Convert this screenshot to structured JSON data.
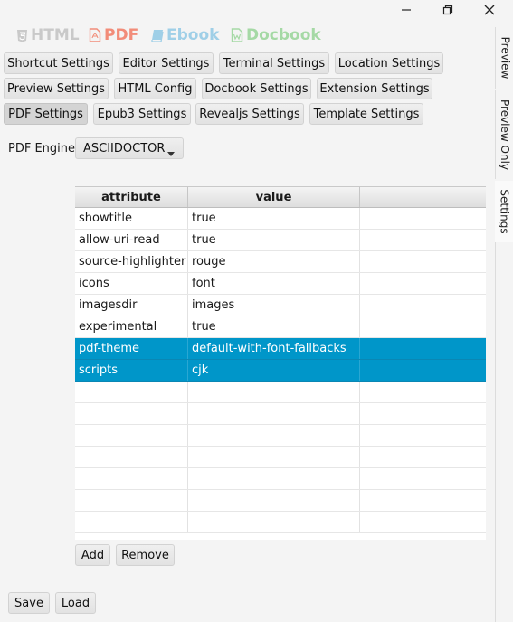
{
  "window": {
    "controls": [
      "minimize-icon",
      "restore-icon",
      "close-icon"
    ]
  },
  "formats": [
    {
      "label": "HTML",
      "icon": "html5-icon",
      "color": "#c9c9c9"
    },
    {
      "label": "PDF",
      "icon": "pdf-file-icon",
      "color": "#f28c79"
    },
    {
      "label": "Ebook",
      "icon": "book-icon",
      "color": "#9fcfe7"
    },
    {
      "label": "Docbook",
      "icon": "docbook-file-icon",
      "color": "#a5d9a5"
    }
  ],
  "tabs": {
    "row1": [
      "Shortcut Settings",
      "Editor Settings",
      "Terminal Settings",
      "Location Settings"
    ],
    "row2": [
      "Preview Settings",
      "HTML Config",
      "Docbook Settings",
      "Extension Settings"
    ],
    "row3": [
      "PDF Settings",
      "Epub3 Settings",
      "Revealjs Settings",
      "Template Settings"
    ],
    "active": "PDF Settings"
  },
  "side_tabs": [
    "Preview",
    "Preview Only",
    "Settings"
  ],
  "engine": {
    "label": "PDF Engine",
    "value": "ASCIIDOCTOR"
  },
  "table": {
    "headers": [
      "attribute",
      "value"
    ],
    "rows": [
      {
        "attribute": "showtitle",
        "value": "true",
        "selected": false
      },
      {
        "attribute": "allow-uri-read",
        "value": "true",
        "selected": false
      },
      {
        "attribute": "source-highlighter",
        "value": "rouge",
        "selected": false
      },
      {
        "attribute": "icons",
        "value": "font",
        "selected": false
      },
      {
        "attribute": "imagesdir",
        "value": "images",
        "selected": false
      },
      {
        "attribute": "experimental",
        "value": "true",
        "selected": false
      },
      {
        "attribute": "pdf-theme",
        "value": "default-with-font-fallbacks",
        "selected": true
      },
      {
        "attribute": "scripts",
        "value": "cjk",
        "selected": true
      }
    ],
    "empty_rows": 7,
    "add_label": "Add",
    "remove_label": "Remove"
  },
  "footer": {
    "save_label": "Save",
    "load_label": "Load"
  },
  "colors": {
    "selection": "#0096c9",
    "background": "#f4f4f4"
  }
}
